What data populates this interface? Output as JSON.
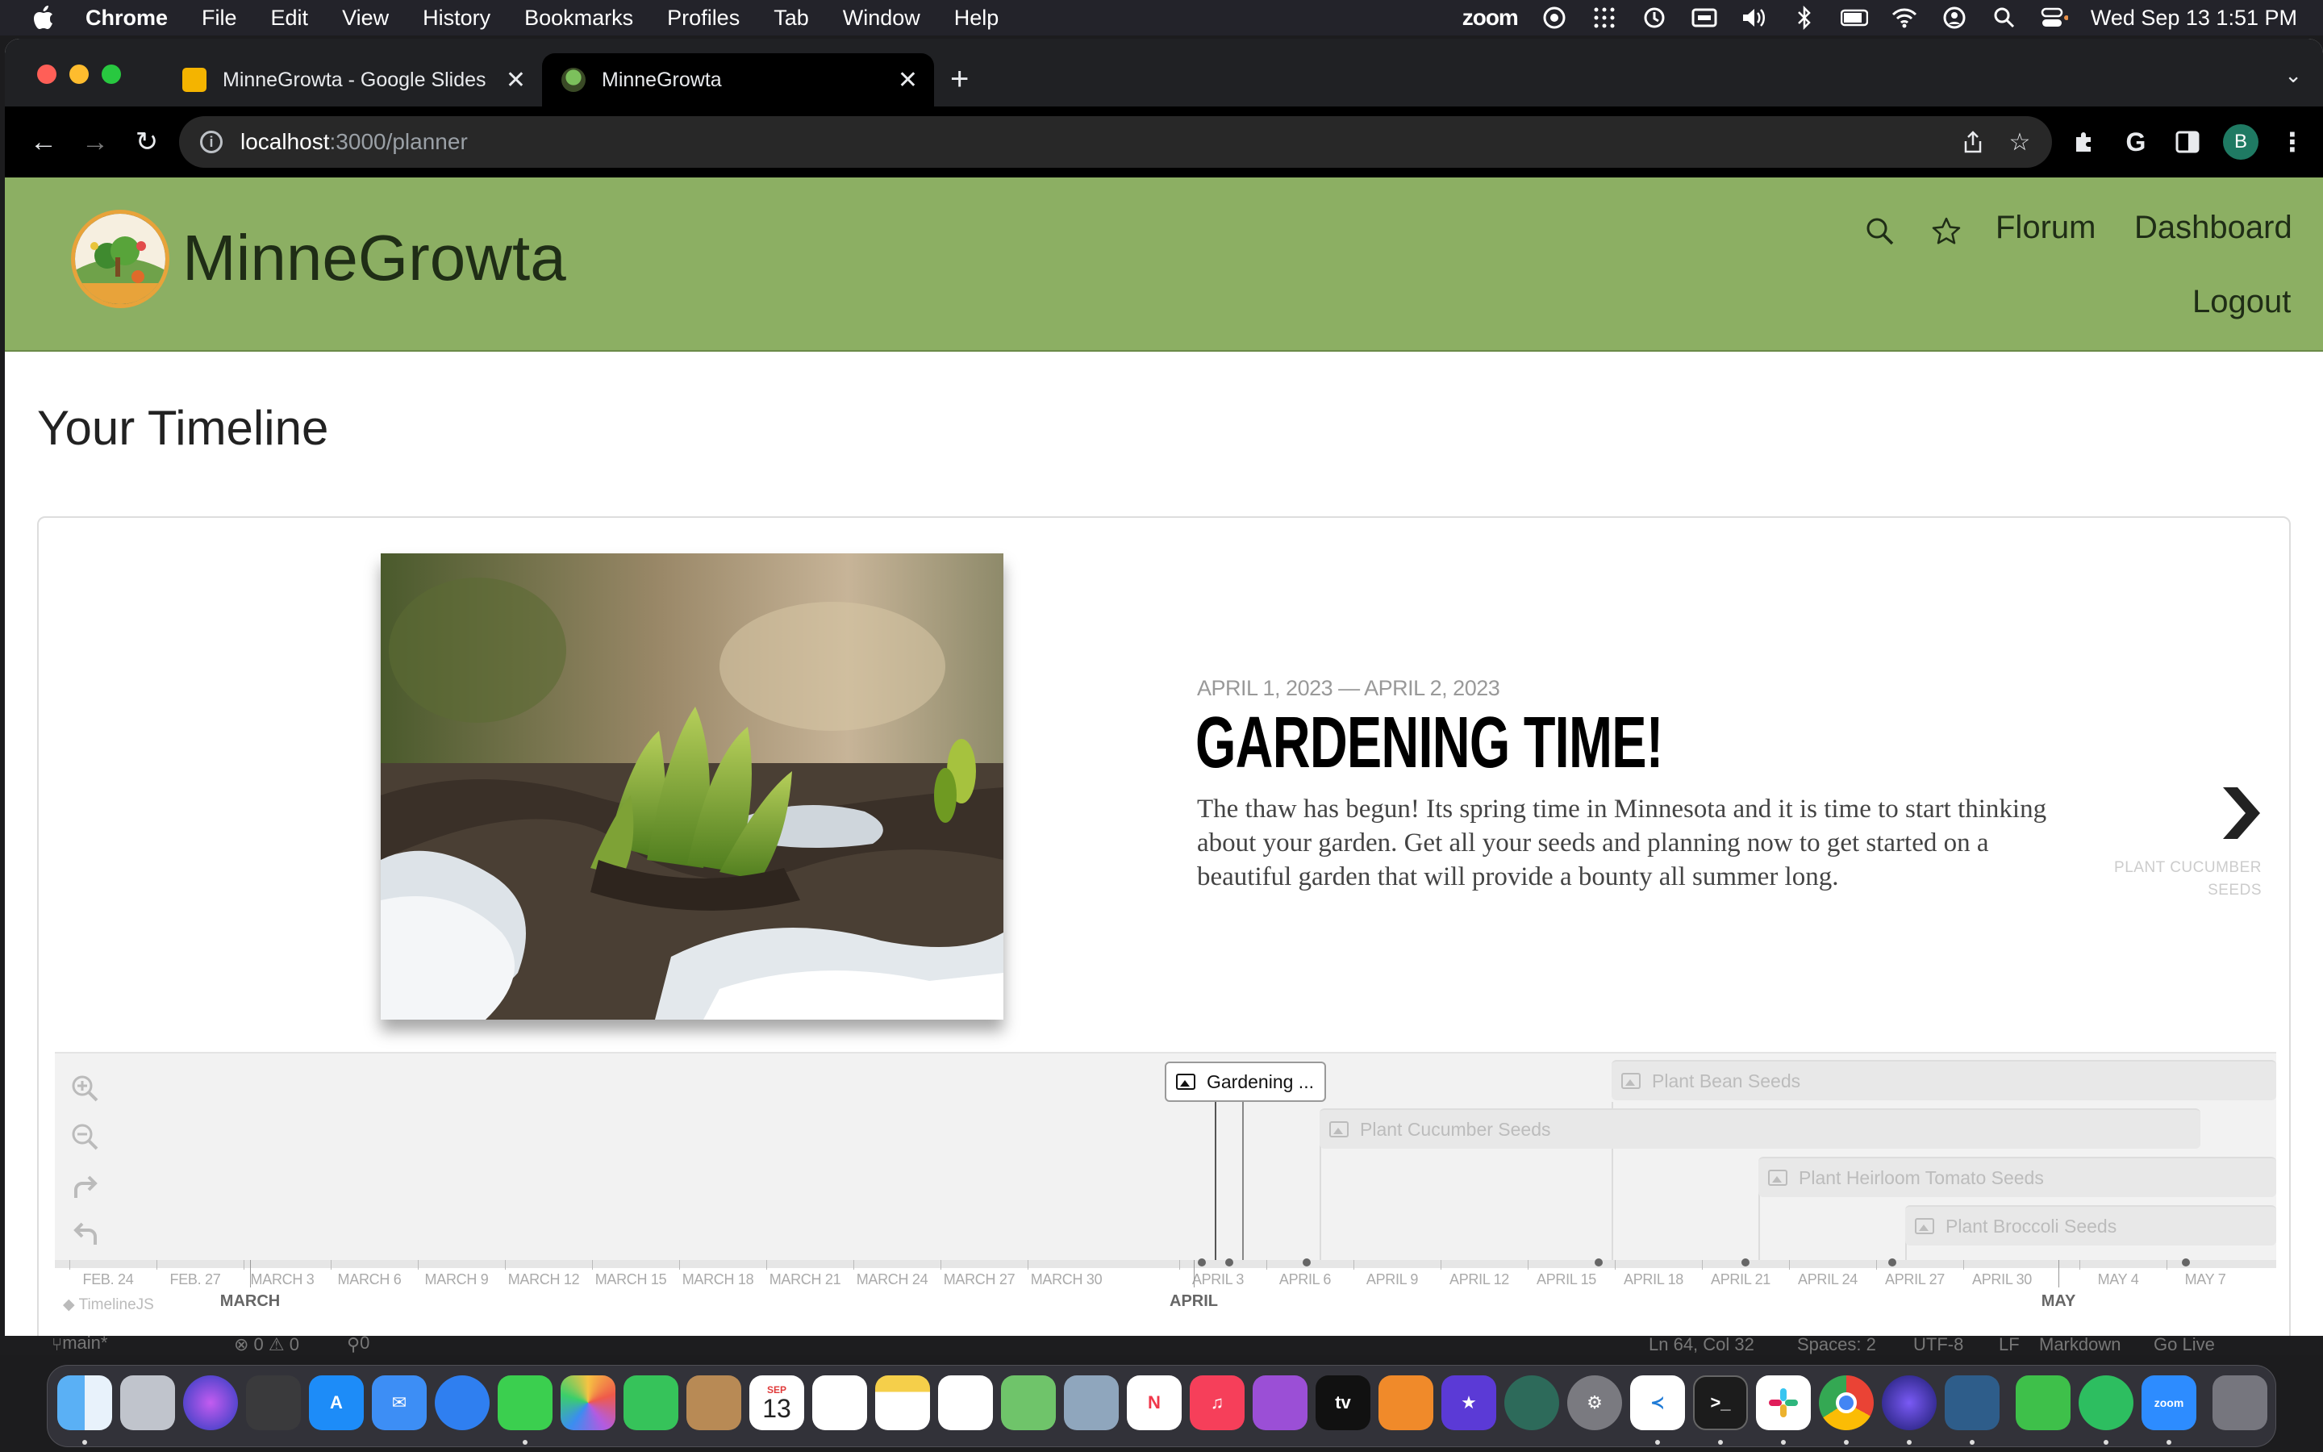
{
  "menubar": {
    "app_name": "Chrome",
    "items": [
      "File",
      "Edit",
      "View",
      "History",
      "Bookmarks",
      "Profiles",
      "Tab",
      "Window",
      "Help"
    ],
    "zoom_label": "zoom",
    "datetime": "Wed Sep 13  1:51 PM"
  },
  "browser": {
    "tabs": [
      {
        "title": "MinneGrowta - Google Slides",
        "active": false
      },
      {
        "title": "MinneGrowta",
        "active": true
      }
    ],
    "url_host": "localhost",
    "url_path": ":3000/planner",
    "profile_initial": "B"
  },
  "site": {
    "title": "MinneGrowta",
    "nav": {
      "florum": "Florum",
      "dashboard": "Dashboard",
      "logout": "Logout"
    }
  },
  "page": {
    "title": "Your Timeline"
  },
  "slide": {
    "date": "APRIL 1, 2023 — APRIL 2, 2023",
    "headline": "GARDENING TIME!",
    "text": "The thaw has begun! Its spring time in Minnesota and it is time to start thinking about your garden. Get all your seeds and planning now to get started on a beautiful garden that will provide a bounty all summer long.",
    "next_label": "PLANT CUCUMBER SEEDS"
  },
  "timeline": {
    "markers": [
      {
        "label": "Gardening ...",
        "active": true
      },
      {
        "label": "Plant Bean Seeds",
        "active": false
      },
      {
        "label": "Plant Cucumber Seeds",
        "active": false
      },
      {
        "label": "Plant Heirloom Tomato Seeds",
        "active": false
      },
      {
        "label": "Plant Broccoli Seeds",
        "active": false
      }
    ],
    "minor_ticks": [
      "FEB. 24",
      "FEB. 27",
      "MARCH 3",
      "MARCH 6",
      "MARCH 9",
      "MARCH 12",
      "MARCH 15",
      "MARCH 18",
      "MARCH 21",
      "MARCH 24",
      "MARCH 27",
      "MARCH 30",
      "APRIL 3",
      "APRIL 6",
      "APRIL 9",
      "APRIL 12",
      "APRIL 15",
      "APRIL 18",
      "APRIL 21",
      "APRIL 24",
      "APRIL 27",
      "APRIL 30",
      "MAY 4",
      "MAY 7"
    ],
    "major_ticks": [
      "MARCH",
      "APRIL",
      "MAY"
    ],
    "attribution": "TimelineJS"
  },
  "vscode_status": {
    "branch": "main*",
    "problems": "⊗ 0 ⚠ 0",
    "ports": "0",
    "position": "Ln 64, Col 32",
    "spaces": "Spaces: 2",
    "encoding": "UTF-8",
    "eol": "LF",
    "language": "Markdown",
    "golive": "Go Live"
  },
  "dock": {
    "calendar_month": "SEP",
    "calendar_day": "13"
  },
  "colors": {
    "header_green": "#8caf63",
    "accent_dark": "#1f2d16"
  }
}
